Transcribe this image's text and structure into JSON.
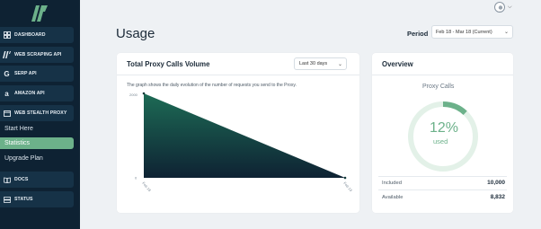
{
  "sidebar": {
    "items": [
      {
        "label": "DASHBOARD",
        "icon": "grid-icon"
      },
      {
        "label": "WEB SCRAPING API",
        "icon": "brand-slashes-icon"
      },
      {
        "label": "SERP API",
        "icon": "google-g-icon"
      },
      {
        "label": "AMAZON API",
        "icon": "amazon-a-icon"
      },
      {
        "label": "WEB STEALTH PROXY",
        "icon": "window-icon"
      },
      {
        "label": "DOCS",
        "icon": "book-icon"
      },
      {
        "label": "STATUS",
        "icon": "server-icon"
      }
    ],
    "sub_items": [
      {
        "label": "Start Here"
      },
      {
        "label": "Statistics",
        "active": true
      },
      {
        "label": "Upgrade Plan"
      }
    ],
    "active_color": "#6cb18a"
  },
  "header": {
    "title": "Usage",
    "period_label": "Period",
    "period_value": "Feb 18 - Mar 18 (Current)"
  },
  "volume_card": {
    "title": "Total Proxy Calls Volume",
    "range_value": "Last 30 days",
    "description": "The graph shows the daily evolution of the number of requests you send to the Proxy."
  },
  "overview_card": {
    "title": "Overview",
    "ring_label": "Proxy Calls",
    "percent_text": "12%",
    "percent_value": 12,
    "used_text": "used",
    "included_label": "Included",
    "included_value": "10,000",
    "available_label": "Available",
    "available_value": "8,832"
  },
  "chart_data": {
    "type": "area",
    "x": [
      "Feb 18",
      "Feb 19"
    ],
    "values": [
      2000,
      0
    ],
    "ylim": [
      0,
      2000
    ],
    "y_ticks": [
      "2000",
      "0"
    ],
    "x_ticks": [
      "Feb 18",
      "Feb 19"
    ],
    "title": "",
    "xlabel": "",
    "ylabel": "",
    "colors": {
      "fill_top": "#1d6b55",
      "fill_bottom": "#0e2233"
    }
  }
}
